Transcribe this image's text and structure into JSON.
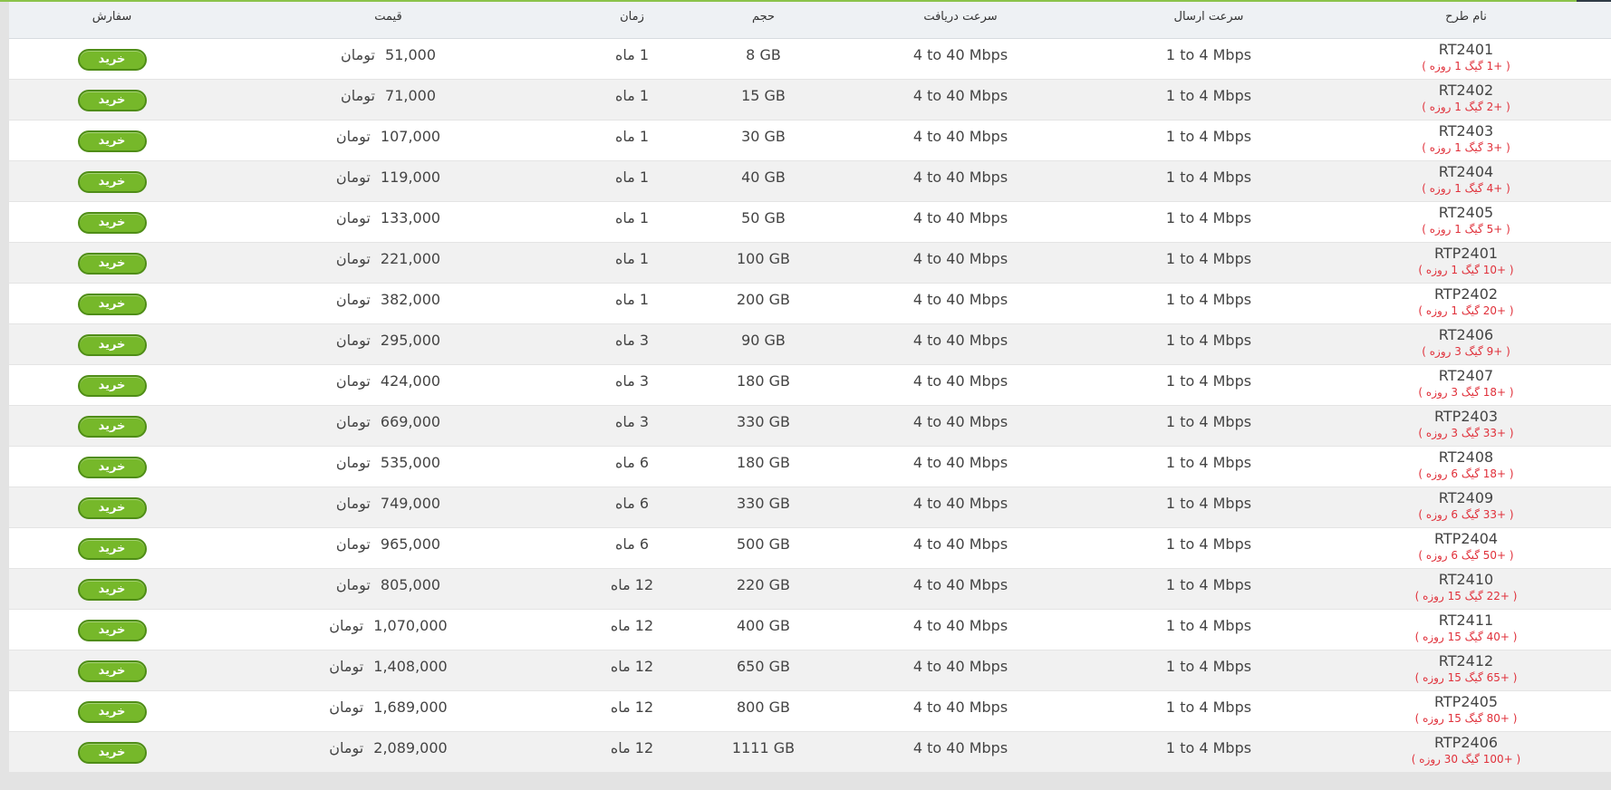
{
  "headers": {
    "plan_name": "نام طرح",
    "upload_speed": "سرعت ارسال",
    "download_speed": "سرعت دریافت",
    "volume": "حجم",
    "duration": "زمان",
    "price": "قیمت",
    "order": "سفارش"
  },
  "labels": {
    "buy": "خرید",
    "currency": "تومان",
    "month_unit": "ماه"
  },
  "colors": {
    "accent_green": "#76b82a",
    "bonus_red": "#e0303a"
  },
  "rows": [
    {
      "code": "RT2401",
      "bonus": "( +1 گیگ 1 روزه )",
      "upload": "1 to 4 Mbps",
      "download": "4 to 40 Mbps",
      "volume": "8 GB",
      "duration": "1",
      "price": "51,000"
    },
    {
      "code": "RT2402",
      "bonus": "( +2 گیگ 1 روزه )",
      "upload": "1 to 4 Mbps",
      "download": "4 to 40 Mbps",
      "volume": "15 GB",
      "duration": "1",
      "price": "71,000"
    },
    {
      "code": "RT2403",
      "bonus": "( +3 گیگ 1 روزه )",
      "upload": "1 to 4 Mbps",
      "download": "4 to 40 Mbps",
      "volume": "30 GB",
      "duration": "1",
      "price": "107,000"
    },
    {
      "code": "RT2404",
      "bonus": "( +4 گیگ 1 روزه )",
      "upload": "1 to 4 Mbps",
      "download": "4 to 40 Mbps",
      "volume": "40 GB",
      "duration": "1",
      "price": "119,000"
    },
    {
      "code": "RT2405",
      "bonus": "( +5 گیگ 1 روزه )",
      "upload": "1 to 4 Mbps",
      "download": "4 to 40 Mbps",
      "volume": "50 GB",
      "duration": "1",
      "price": "133,000"
    },
    {
      "code": "RTP2401",
      "bonus": "( +10 گیگ 1 روزه )",
      "upload": "1 to 4 Mbps",
      "download": "4 to 40 Mbps",
      "volume": "100 GB",
      "duration": "1",
      "price": "221,000"
    },
    {
      "code": "RTP2402",
      "bonus": "( +20 گیگ 1 روزه )",
      "upload": "1 to 4 Mbps",
      "download": "4 to 40 Mbps",
      "volume": "200 GB",
      "duration": "1",
      "price": "382,000"
    },
    {
      "code": "RT2406",
      "bonus": "( +9 گیگ 3 روزه )",
      "upload": "1 to 4 Mbps",
      "download": "4 to 40 Mbps",
      "volume": "90 GB",
      "duration": "3",
      "price": "295,000"
    },
    {
      "code": "RT2407",
      "bonus": "( +18 گیگ 3 روزه )",
      "upload": "1 to 4 Mbps",
      "download": "4 to 40 Mbps",
      "volume": "180 GB",
      "duration": "3",
      "price": "424,000"
    },
    {
      "code": "RTP2403",
      "bonus": "( +33 گیگ 3 روزه )",
      "upload": "1 to 4 Mbps",
      "download": "4 to 40 Mbps",
      "volume": "330 GB",
      "duration": "3",
      "price": "669,000"
    },
    {
      "code": "RT2408",
      "bonus": "( +18 گیگ 6 روزه )",
      "upload": "1 to 4 Mbps",
      "download": "4 to 40 Mbps",
      "volume": "180 GB",
      "duration": "6",
      "price": "535,000"
    },
    {
      "code": "RT2409",
      "bonus": "( +33 گیگ 6 روزه )",
      "upload": "1 to 4 Mbps",
      "download": "4 to 40 Mbps",
      "volume": "330 GB",
      "duration": "6",
      "price": "749,000"
    },
    {
      "code": "RTP2404",
      "bonus": "( +50 گیگ 6 روزه )",
      "upload": "1 to 4 Mbps",
      "download": "4 to 40 Mbps",
      "volume": "500 GB",
      "duration": "6",
      "price": "965,000"
    },
    {
      "code": "RT2410",
      "bonus": "( +22 گیگ 15 روزه )",
      "upload": "1 to 4 Mbps",
      "download": "4 to 40 Mbps",
      "volume": "220 GB",
      "duration": "12",
      "price": "805,000"
    },
    {
      "code": "RT2411",
      "bonus": "( +40 گیگ 15 روزه )",
      "upload": "1 to 4 Mbps",
      "download": "4 to 40 Mbps",
      "volume": "400 GB",
      "duration": "12",
      "price": "1,070,000"
    },
    {
      "code": "RT2412",
      "bonus": "( +65 گیگ 15 روزه )",
      "upload": "1 to 4 Mbps",
      "download": "4 to 40 Mbps",
      "volume": "650 GB",
      "duration": "12",
      "price": "1,408,000"
    },
    {
      "code": "RTP2405",
      "bonus": "( +80 گیگ 15 روزه )",
      "upload": "1 to 4 Mbps",
      "download": "4 to 40 Mbps",
      "volume": "800 GB",
      "duration": "12",
      "price": "1,689,000"
    },
    {
      "code": "RTP2406",
      "bonus": "( +100 گیگ 30 روزه )",
      "upload": "1 to 4 Mbps",
      "download": "4 to 40 Mbps",
      "volume": "1111 GB",
      "duration": "12",
      "price": "2,089,000"
    }
  ]
}
